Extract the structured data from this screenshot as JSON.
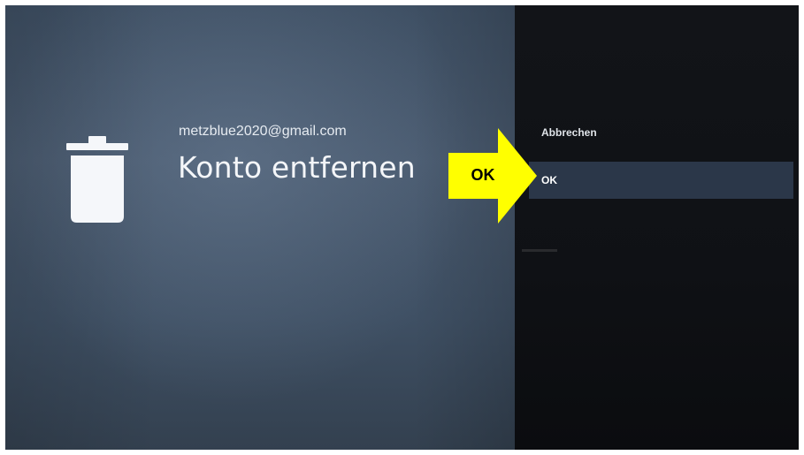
{
  "dialog": {
    "account_email": "metzblue2020@gmail.com",
    "title": "Konto entfernen",
    "icon": "trash-icon"
  },
  "menu": {
    "items": [
      {
        "label": "Abbrechen",
        "focused": false
      },
      {
        "label": "OK",
        "focused": true
      }
    ]
  },
  "annotation": {
    "label": "OK",
    "color": "#ffff00",
    "icon": "arrow-right-icon"
  },
  "colors": {
    "left_pane": "#44566b",
    "right_pane": "#111317",
    "focused_item": "#2b3749",
    "text": "#ffffff"
  }
}
